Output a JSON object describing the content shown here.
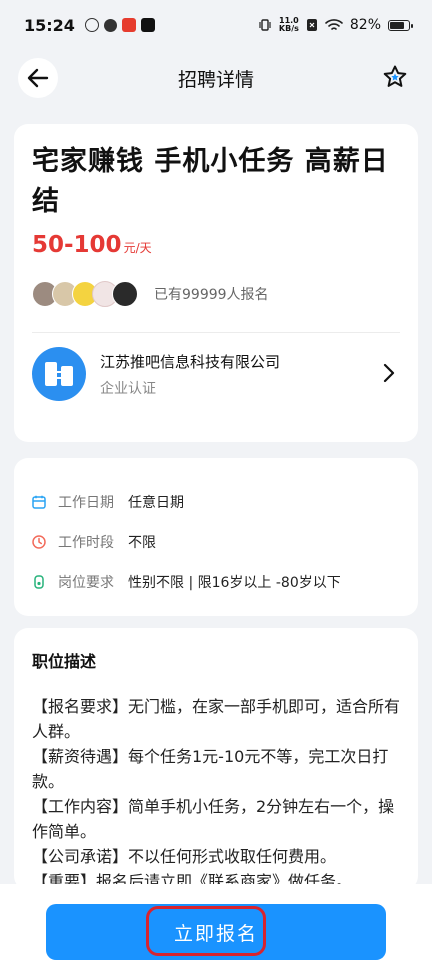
{
  "status_bar": {
    "time": "15:24",
    "net_speed_value": "11.0",
    "net_speed_unit": "KB/s",
    "battery": "82%",
    "battery_level": 0.82
  },
  "header": {
    "title": "招聘详情",
    "back_icon": "arrow-left-icon",
    "favorite_icon": "star-icon"
  },
  "job": {
    "title": "宅家赚钱 手机小任务 高薪日结",
    "salary_amount": "50-100",
    "salary_unit": "元/天",
    "applicants_text": "已有99999人报名"
  },
  "company": {
    "name": "江苏推吧信息科技有限公司",
    "verification": "企业认证"
  },
  "details": [
    {
      "icon": "calendar-icon",
      "label": "工作日期",
      "value": "任意日期",
      "color": "#2aa4f4"
    },
    {
      "icon": "clock-icon",
      "label": "工作时段",
      "value": "不限",
      "color": "#f26b5b"
    },
    {
      "icon": "badge-icon",
      "label": "岗位要求",
      "value": "性别不限 | 限16岁以上 -80岁以下",
      "color": "#26b27a"
    }
  ],
  "description": {
    "title": "职位描述",
    "lines": [
      "【报名要求】无门槛，在家一部手机即可，适合所有人群。",
      "【薪资待遇】每个任务1元-10元不等，完工次日打款。",
      "【工作内容】简单手机小任务，2分钟左右一个，操作简单。",
      "【公司承诺】不以任何形式收取任何费用。",
      "【重要】报名后请立即《联系商家》做任务。"
    ]
  },
  "cta": {
    "label": "立即报名",
    "color": "#1a93ff"
  }
}
